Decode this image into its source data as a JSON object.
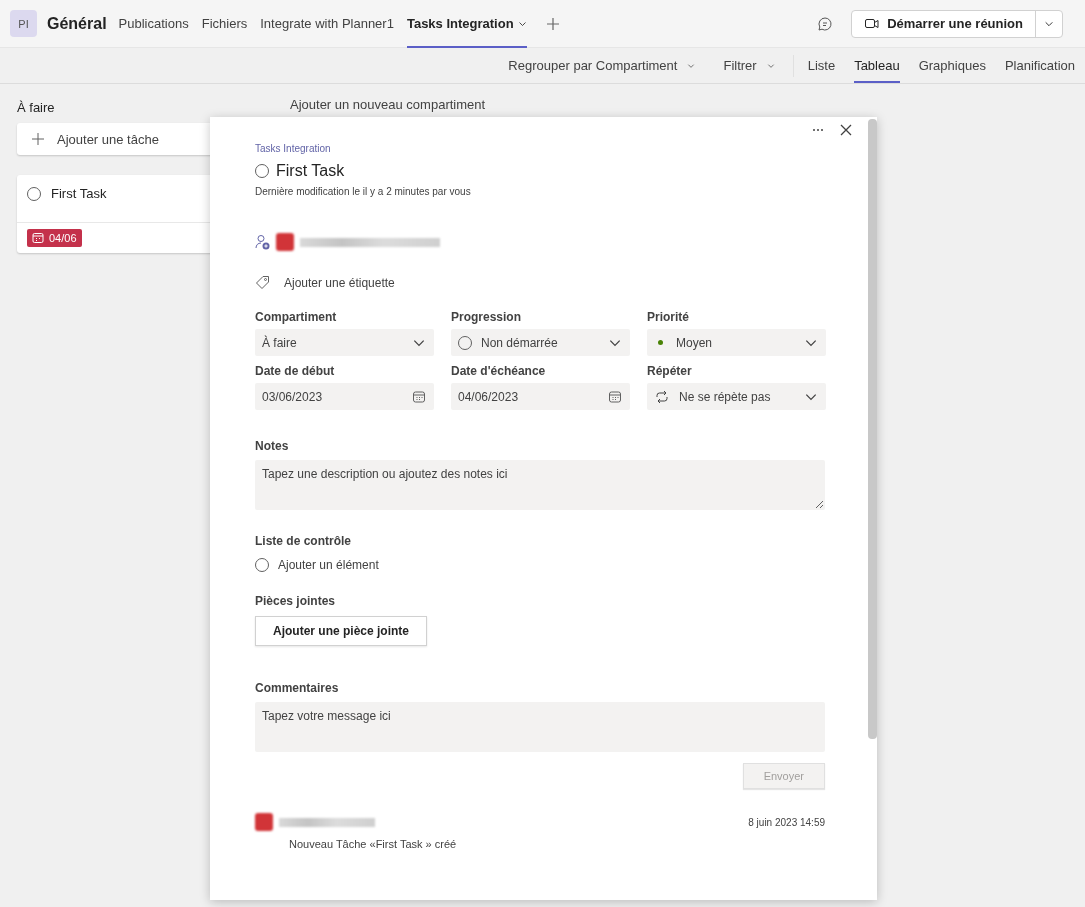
{
  "team": {
    "initials": "PI",
    "name": "Général"
  },
  "channel_tabs": [
    {
      "label": "Publications",
      "selected": false,
      "dropdown": false
    },
    {
      "label": "Fichiers",
      "selected": false,
      "dropdown": false
    },
    {
      "label": "Integrate with Planner1",
      "selected": false,
      "dropdown": false
    },
    {
      "label": "Tasks Integration",
      "selected": true,
      "dropdown": true
    }
  ],
  "meeting_button": {
    "label": "Démarrer une réunion"
  },
  "toolbar": {
    "group_by": "Regrouper par Compartiment",
    "filter": "Filtrer",
    "views": [
      {
        "label": "Liste",
        "selected": false
      },
      {
        "label": "Tableau",
        "selected": true
      },
      {
        "label": "Graphiques",
        "selected": false
      },
      {
        "label": "Planification",
        "selected": false
      }
    ]
  },
  "board": {
    "buckets": [
      {
        "title": "À faire",
        "add_task": "Ajouter une tâche",
        "tasks": [
          {
            "title": "First Task",
            "completed": false,
            "due": "04/06",
            "overdue": true
          }
        ]
      }
    ],
    "add_bucket": "Ajouter un nouveau compartiment"
  },
  "task_panel": {
    "plan": "Tasks Integration",
    "title": "First Task",
    "completed": false,
    "modified": "Dernière modification le il y a 2 minutes par vous",
    "add_label": "Ajouter une étiquette",
    "fields": [
      {
        "label": "Compartiment",
        "value": "À faire",
        "kind": "dropdown"
      },
      {
        "label": "Progression",
        "value": "Non démarrée",
        "kind": "progress"
      },
      {
        "label": "Priorité",
        "value": "Moyen",
        "kind": "priority"
      },
      {
        "label": "Date de début",
        "value": "03/06/2023",
        "kind": "date"
      },
      {
        "label": "Date d'échéance",
        "value": "04/06/2023",
        "kind": "date"
      },
      {
        "label": "Répéter",
        "value": "Ne se répète pas",
        "kind": "repeat"
      }
    ],
    "notes": {
      "label": "Notes",
      "placeholder": "Tapez une description ou ajoutez des notes ici"
    },
    "checklist": {
      "label": "Liste de contrôle",
      "placeholder": "Ajouter un élément"
    },
    "attachments": {
      "label": "Pièces jointes",
      "button": "Ajouter une pièce jointe"
    },
    "comments": {
      "label": "Commentaires",
      "placeholder": "Tapez votre message ici",
      "send": "Envoyer",
      "send_disabled": true,
      "entries": [
        {
          "time": "8 juin 2023 14:59",
          "text": "Nouveau Tâche «First Task » créé"
        }
      ]
    }
  }
}
